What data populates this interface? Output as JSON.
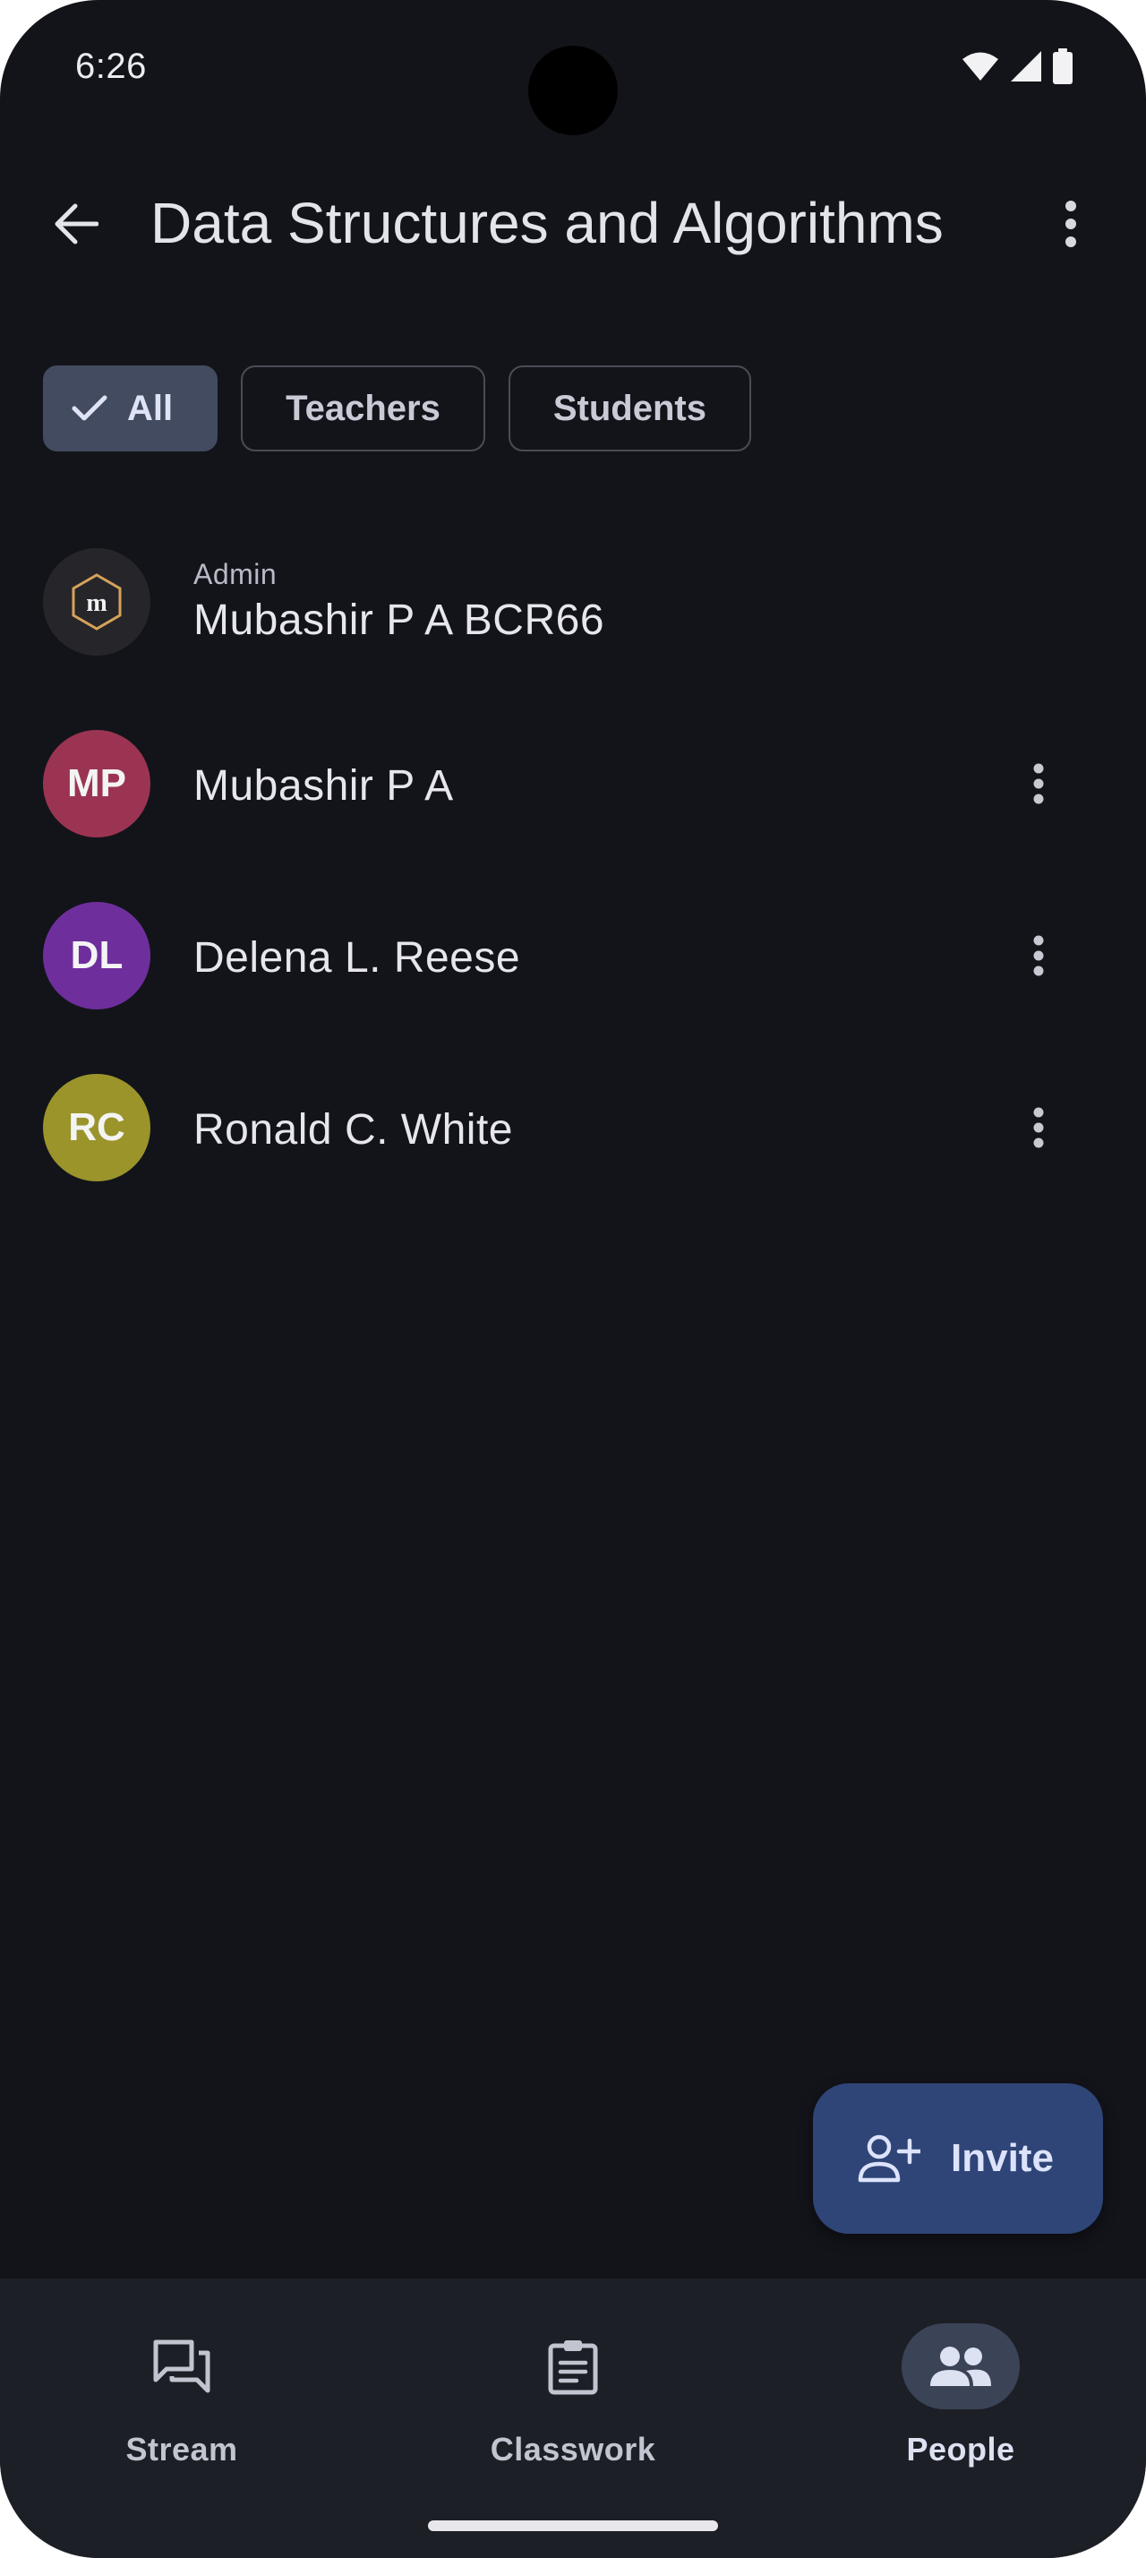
{
  "status_bar": {
    "time": "6:26",
    "icons": [
      "wifi-icon",
      "signal-icon",
      "battery-icon"
    ]
  },
  "app_bar": {
    "title": "Data Structures and Algorithms",
    "back_icon": "arrow-back-icon",
    "menu_icon": "more-vert-icon"
  },
  "filters": {
    "chips": [
      {
        "label": "All",
        "selected": true
      },
      {
        "label": "Teachers",
        "selected": false
      },
      {
        "label": "Students",
        "selected": false
      }
    ]
  },
  "people": [
    {
      "role": "Admin",
      "name": "Mubashir P A BCR66",
      "avatar": "logo",
      "avatar_color": "#26262a"
    },
    {
      "name": "Mubashir P A",
      "initials": "MP",
      "avatar_color": "#9b3452"
    },
    {
      "name": "Delena L. Reese",
      "initials": "DL",
      "avatar_color": "#6e2f9c"
    },
    {
      "name": "Ronald C. White",
      "initials": "RC",
      "avatar_color": "#9a942b"
    }
  ],
  "fab": {
    "label": "Invite",
    "icon": "person-add-icon"
  },
  "bottom_nav": {
    "items": [
      {
        "label": "Stream",
        "icon": "forum-icon",
        "active": false
      },
      {
        "label": "Classwork",
        "icon": "assignment-icon",
        "active": false
      },
      {
        "label": "People",
        "icon": "people-icon",
        "active": true
      }
    ]
  },
  "colors": {
    "background": "#13141a",
    "nav_background": "#1d1f26",
    "accent_chip": "#434b60",
    "fab": "#2f4577"
  }
}
